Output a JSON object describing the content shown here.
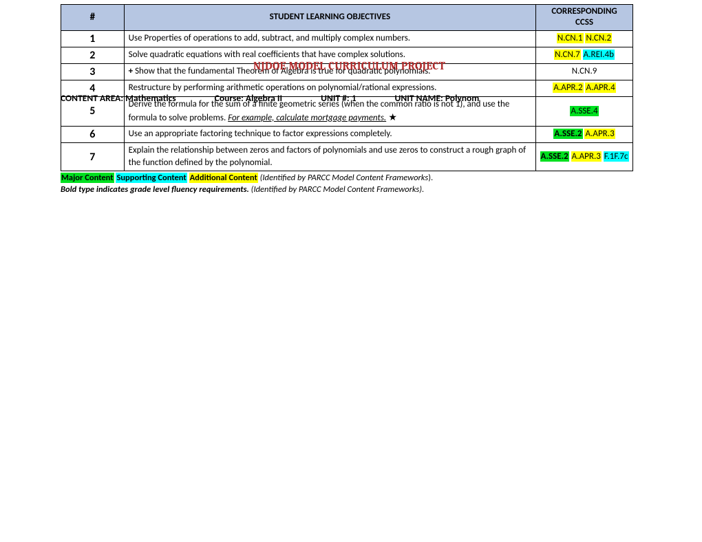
{
  "header": {
    "num": "#",
    "obj": "STUDENT LEARNING OBJECTIVES",
    "ccss1": "CORRESPONDING",
    "ccss2": "CCSS"
  },
  "overlay": {
    "title": "NJDOE MODEL CURRICULUM PROJECT",
    "area_label": "CONTENT AREA:",
    "area_value": "Mathematics",
    "course_label": "Course:",
    "course_value": "Algebra II",
    "unitnum_label": "UNIT #:",
    "unitnum_value": "1",
    "unitname_label": "UNIT NAME:",
    "unitname_value": "Polynom"
  },
  "rows": {
    "r1": {
      "num": "1",
      "obj": "Use Properties of operations to add, subtract, and multiply complex numbers.",
      "cc1": "N.CN.1",
      "cc2": "N.CN.2"
    },
    "r2": {
      "num": "2",
      "obj": "Solve quadratic equations with real coefficients that have complex solutions.",
      "cc1": "N.CN.7",
      "cc2": "A.REI.4b"
    },
    "r3": {
      "num": "3",
      "plus": "+",
      "obj": " Show that the fundamental Theorem of Algebra is true for quadratic polynomials.",
      "cc1": "N.CN.9"
    },
    "r4": {
      "num": "4",
      "obj": "Restructure by performing arithmetic operations on polynomial/rational expressions.",
      "cc1": "A.APR.2",
      "cc2": "A.APR.4"
    },
    "r5": {
      "num": "5",
      "obj_a": "Derive the formula for the sum of a finite geometric series (when the common ratio is not 1), and use the formula to solve problems. ",
      "obj_b": "For example, calculate mortgage payments.",
      "star": " ★",
      "cc1": "A.SSE.4"
    },
    "r6": {
      "num": "6",
      "obj": "Use an appropriate factoring technique to factor expressions completely.",
      "cc1": "A.SSE.2",
      "cc2": "A.APR.3"
    },
    "r7": {
      "num": "7",
      "obj": "Explain the relationship between zeros and factors of polynomials and use zeros to construct a rough graph of the function defined by the polynomial.",
      "cc1": "A.SSE.2",
      "cc2": "A.APR.3",
      "cc3": "F.1F.7c"
    }
  },
  "legend": {
    "major": "Major Content",
    "supporting": "Supporting Content",
    "additional": "Additional Content",
    "ident": " (Identified by PARCC Model Content Frameworks",
    "paren": ").",
    "bold_line": "Bold type indicates grade level fluency requirements.",
    "ident2": " (Identified by PARCC Model Content Frameworks)."
  }
}
